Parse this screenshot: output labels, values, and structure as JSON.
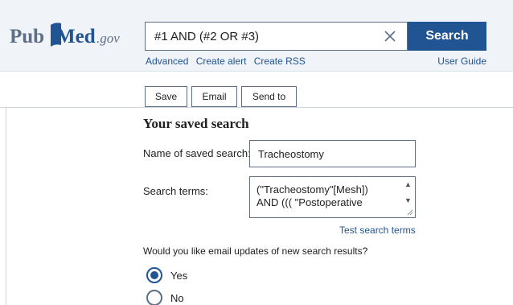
{
  "header": {
    "logo": {
      "pub": "Pub",
      "med": "Med",
      "gov": ".gov"
    },
    "search": {
      "value": "#1 AND (#2 OR #3)",
      "button_label": "Search",
      "clear_icon": "close-icon"
    },
    "links": [
      "Advanced",
      "Create alert",
      "Create RSS"
    ],
    "user_guide": "User Guide"
  },
  "actions": {
    "save": "Save",
    "email": "Email",
    "send_to": "Send to"
  },
  "saved_search": {
    "title": "Your saved search",
    "name_label": "Name of saved search:",
    "name_value": "Tracheostomy",
    "terms_label": "Search terms:",
    "terms_value": "(\"Tracheostomy\"[Mesh])\nAND ((( \"Postoperative",
    "test_link": "Test search terms",
    "question": "Would you like email updates of new search results?",
    "options": [
      {
        "label": "Yes",
        "checked": true
      },
      {
        "label": "No",
        "checked": false
      }
    ]
  },
  "colors": {
    "brand_blue": "#205493",
    "header_bg": "#f0f3f7",
    "logo_gray": "#5c6f87"
  }
}
